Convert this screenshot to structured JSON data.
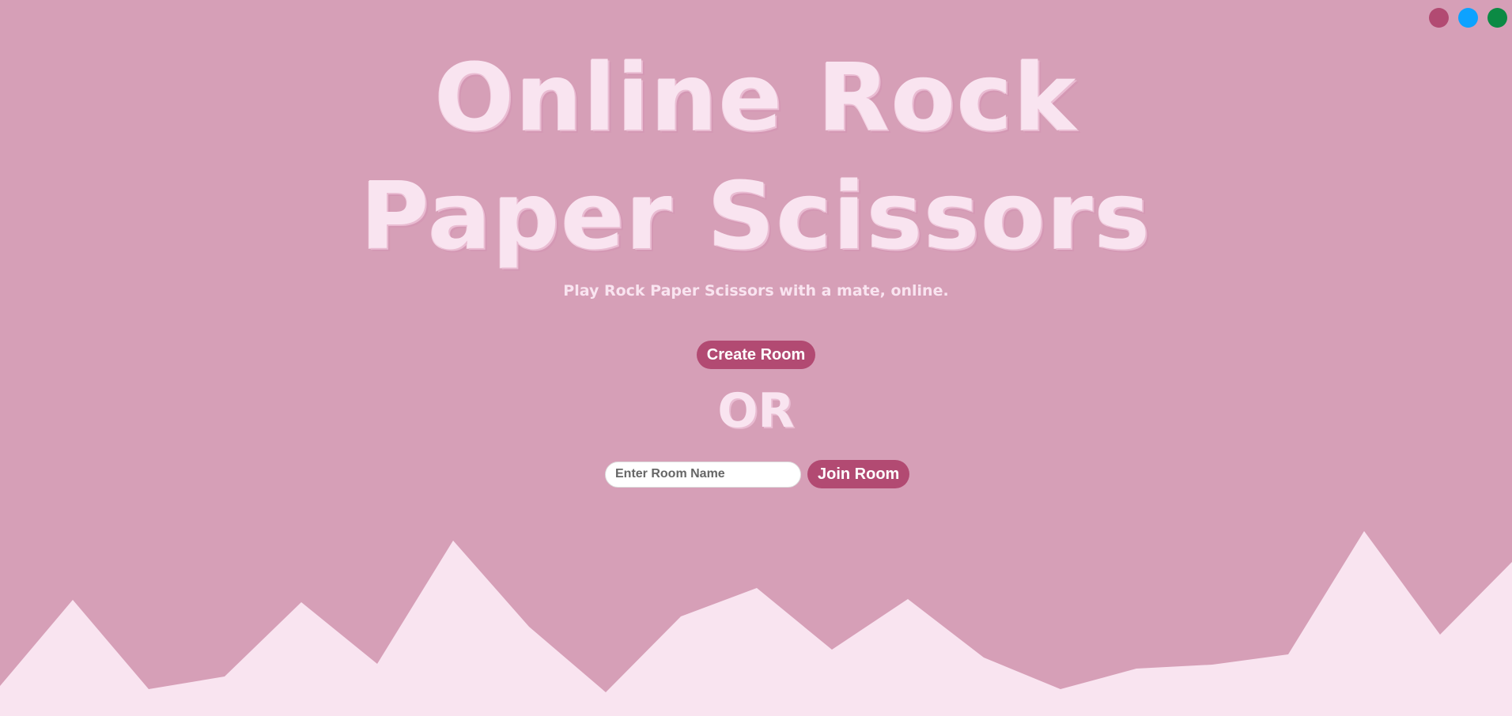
{
  "theme_switcher": {
    "colors": [
      "#b24a72",
      "#0da2ff",
      "#0b8a44"
    ]
  },
  "header": {
    "title_line1": "Online Rock",
    "title_line2": "Paper Scissors",
    "subtitle": "Play Rock Paper Scissors with a mate, online."
  },
  "actions": {
    "create_label": "Create Room",
    "or_label": "OR",
    "room_input_placeholder": "Enter Room Name",
    "room_input_value": "",
    "join_label": "Join Room"
  },
  "colors": {
    "background": "#d69fb7",
    "accent": "#b24a72",
    "text_light": "#f9e4f0",
    "mountains": "#f9e4f0"
  }
}
